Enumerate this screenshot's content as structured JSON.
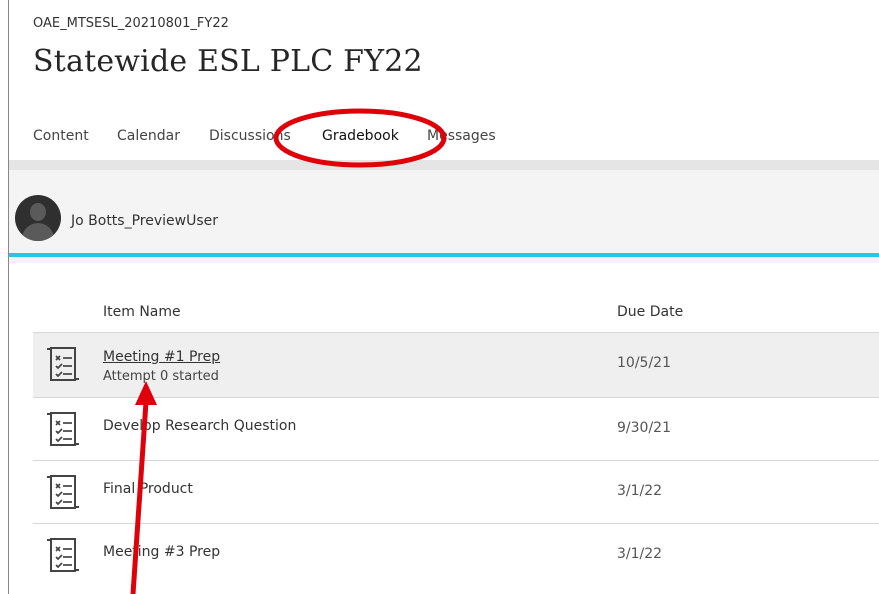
{
  "course": {
    "code": "OAE_MTSESL_20210801_FY22",
    "title": "Statewide ESL PLC FY22"
  },
  "tabs": [
    {
      "label": "Content"
    },
    {
      "label": "Calendar"
    },
    {
      "label": "Discussions"
    },
    {
      "label": "Gradebook",
      "active": true
    },
    {
      "label": "Messages"
    }
  ],
  "user": {
    "name": "Jo Botts_PreviewUser"
  },
  "table": {
    "columns": {
      "item_name": "Item Name",
      "due_date": "Due Date"
    },
    "rows": [
      {
        "icon": "assignment-checklist-icon",
        "name": "Meeting #1 Prep",
        "status": "Attempt 0 started",
        "due": "10/5/21"
      },
      {
        "icon": "assignment-checklist-icon",
        "name": "Develop Research Question",
        "due": "9/30/21"
      },
      {
        "icon": "assignment-checklist-icon",
        "name": "Final Product",
        "due": "3/1/22"
      },
      {
        "icon": "assignment-checklist-icon",
        "name": "Meeting #3 Prep",
        "due": "3/1/22"
      }
    ]
  },
  "annotations": {
    "color": "#e0000a",
    "circle_target": "Gradebook",
    "arrow_target": "Meeting #1 Prep"
  },
  "colors": {
    "accent": "#28c4ea",
    "annotation": "#e0000a"
  }
}
